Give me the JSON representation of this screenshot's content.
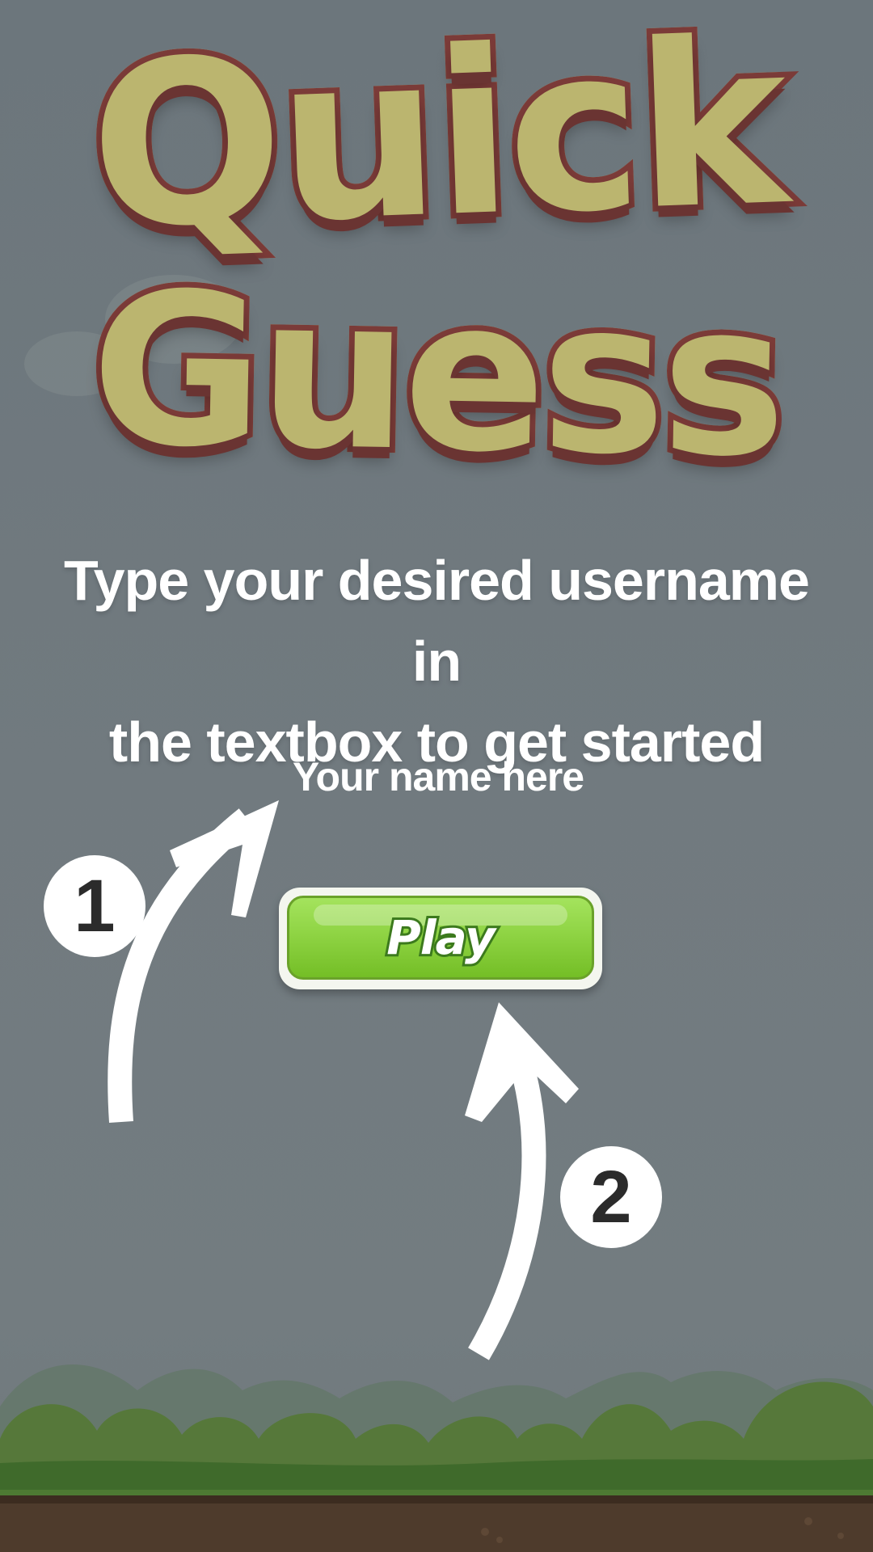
{
  "title": {
    "line1": "Quick",
    "line2": "Guess"
  },
  "instructions": {
    "line1": "Type your desired username in",
    "line2": "the textbox to get started"
  },
  "username_input": {
    "placeholder": "Your name here",
    "value": ""
  },
  "play_button": {
    "label": "Play"
  },
  "steps": [
    {
      "number": "1"
    },
    {
      "number": "2"
    }
  ],
  "colors": {
    "background": "#717a7f",
    "title_fill": "#bbb56f",
    "title_outline": "#7b3b38",
    "play_green": "#8fd444",
    "play_outline": "#3c7a1d",
    "foliage": "#56783a",
    "dirt": "#4e3b2c"
  }
}
